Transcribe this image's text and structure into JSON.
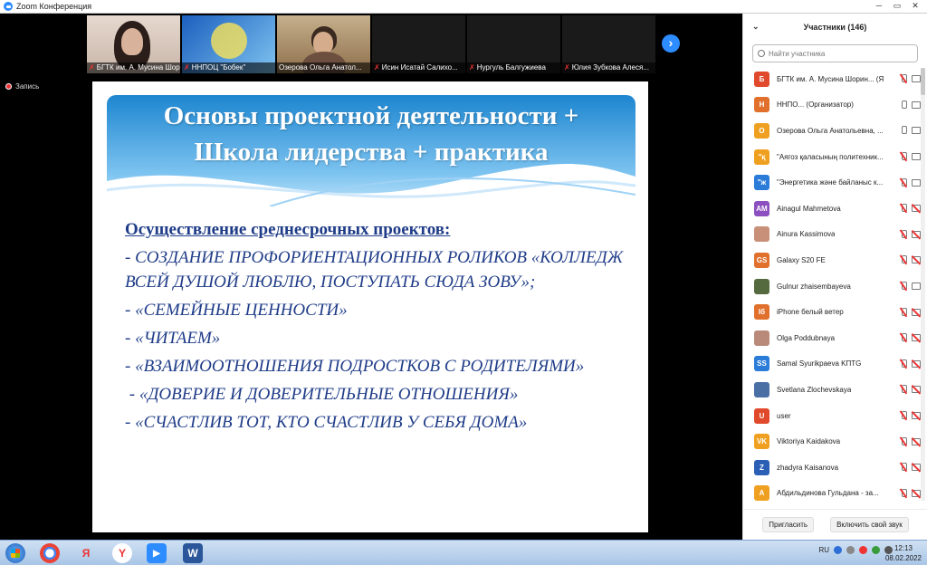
{
  "window": {
    "title": "Zoom Конференция"
  },
  "video_strip": {
    "tiles": [
      {
        "name": "БГТК им. А. Мусина Шори..."
      },
      {
        "name": "ННПОЦ \"Бобек\""
      },
      {
        "name": "Озерова Ольга Анатол..."
      },
      {
        "name": "Исин Исатай Салихо..."
      },
      {
        "name": "Нургуль Балгужиева"
      },
      {
        "name": "Юлия Зубкова Алеся..."
      }
    ]
  },
  "recording": {
    "label": "Запись"
  },
  "slide": {
    "title_line1": "Основы проектной деятельности +",
    "title_line2": "Школа лидерства + практика",
    "subheading": "Осуществление среднесрочных проектов:",
    "items": [
      "- СОЗДАНИЕ ПРОФОРИЕНТАЦИОННЫХ РОЛИКОВ «КОЛЛЕДЖ ВСЕЙ ДУШОЙ ЛЮБЛЮ, ПОСТУПАТЬ СЮДА ЗОВУ»;",
      "- «СЕМЕЙНЫЕ ЦЕННОСТИ»",
      "- «ЧИТАЕМ»",
      "- «ВЗАИМООТНОШЕНИЯ ПОДРОСТКОВ С РОДИТЕЛЯМИ»",
      " - «ДОВЕРИЕ И ДОВЕРИТЕЛЬНЫЕ ОТНОШЕНИЯ»",
      "- «СЧАСТЛИВ ТОТ, КТО СЧАСТЛИВ У СЕБЯ ДОМА»"
    ]
  },
  "participants": {
    "header": "Участники (146)",
    "search_placeholder": "Найти участника",
    "list": [
      {
        "initial": "Б",
        "name": "БГТК им. А. Мусина Шорин... (Я)",
        "color": "#e0492b",
        "mic": "off",
        "cam": "on"
      },
      {
        "initial": "Н",
        "name": "ННПО... (Организатор)",
        "color": "#e0702b",
        "mic": "on",
        "cam": "on"
      },
      {
        "initial": "О",
        "name": "Озерова Ольга Анатольевна, ...",
        "color": "#f0a020",
        "mic": "on",
        "cam": "on"
      },
      {
        "initial": "\"қ",
        "name": "\"Аягоз қаласының политехник...",
        "color": "#f0a020",
        "mic": "off",
        "cam": "on"
      },
      {
        "initial": "\"ж",
        "name": "\"Энергетика және байланыс к...",
        "color": "#2b7bd8",
        "mic": "off",
        "cam": "on"
      },
      {
        "initial": "AM",
        "name": "Ainagul Mahmetova",
        "color": "#8b4fbf",
        "mic": "off",
        "cam": "off"
      },
      {
        "initial": "",
        "name": "Ainura Kassimova",
        "color": "#c89078",
        "mic": "off",
        "cam": "off"
      },
      {
        "initial": "GS",
        "name": "Galaxy S20 FE",
        "color": "#e0702b",
        "mic": "off",
        "cam": "off"
      },
      {
        "initial": "",
        "name": "Gulnur zhaisembayeva",
        "color": "#556b3f",
        "mic": "off",
        "cam": "on"
      },
      {
        "initial": "Iб",
        "name": "iPhone белый ветер",
        "color": "#e0702b",
        "mic": "off",
        "cam": "off"
      },
      {
        "initial": "",
        "name": "Olga Poddubnaya",
        "color": "#b98a7a",
        "mic": "off",
        "cam": "off"
      },
      {
        "initial": "SS",
        "name": "Samal Syurikpaeva KПТG",
        "color": "#2b7bd8",
        "mic": "off",
        "cam": "off"
      },
      {
        "initial": "",
        "name": "Svetlana Zlochevskaya",
        "color": "#4a6fa5",
        "mic": "off",
        "cam": "off"
      },
      {
        "initial": "U",
        "name": "user",
        "color": "#e0492b",
        "mic": "off",
        "cam": "off"
      },
      {
        "initial": "VK",
        "name": "Viktoriya Kaidakova",
        "color": "#f0a020",
        "mic": "off",
        "cam": "off"
      },
      {
        "initial": "Z",
        "name": "zhadyra Kaisanova",
        "color": "#2b5fb5",
        "mic": "off",
        "cam": "off"
      },
      {
        "initial": "А",
        "name": "Абдильдинова Гульдана - за...",
        "color": "#f0a020",
        "mic": "off",
        "cam": "off"
      }
    ],
    "invite_label": "Пригласить",
    "unmute_label": "Включить свой звук"
  },
  "taskbar": {
    "lang": "RU",
    "time": "12:13",
    "date": "08.02.2022"
  }
}
